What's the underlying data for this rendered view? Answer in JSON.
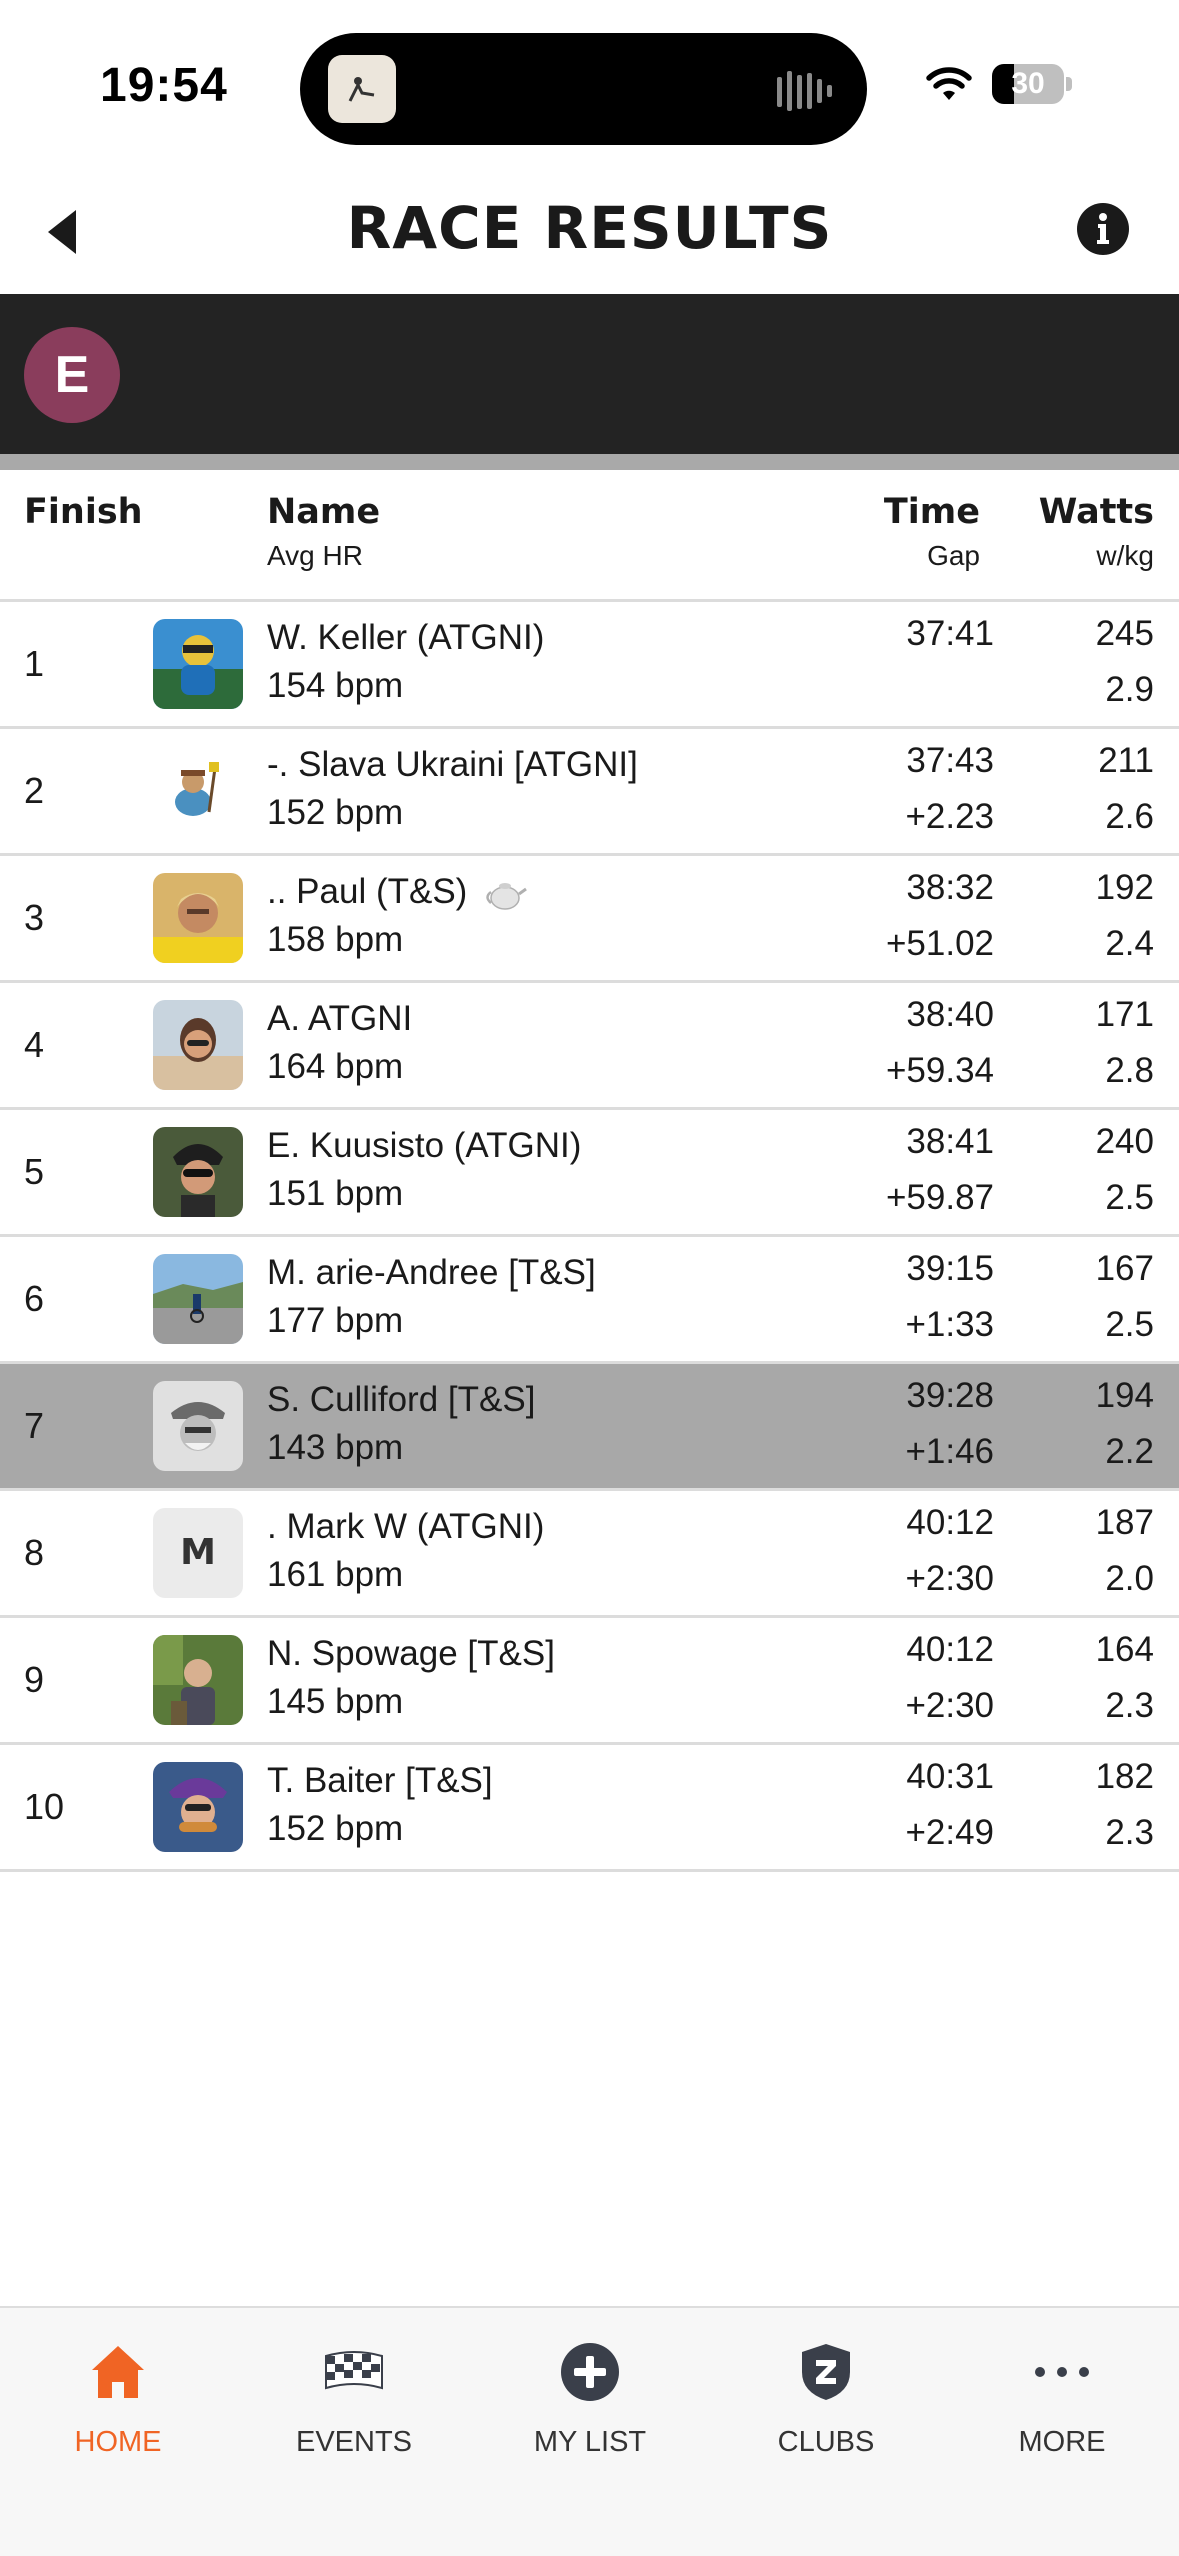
{
  "status": {
    "time": "19:54",
    "battery": "30",
    "battery_fraction": 0.3
  },
  "header": {
    "title": "RACE RESULTS"
  },
  "category": {
    "badge": "E",
    "color": "#8a3d5c"
  },
  "columns": {
    "finish": "Finish",
    "name": "Name",
    "name_sub": "Avg HR",
    "time": "Time",
    "time_sub": "Gap",
    "watts": "Watts",
    "watts_sub": "w/kg"
  },
  "rows": [
    {
      "pos": "1",
      "name": "W. Keller (ATGNI)",
      "hr": "154 bpm",
      "time": "37:41",
      "gap": "",
      "watts": "245",
      "wkg": "2.9",
      "avatar": "photo-cyclist"
    },
    {
      "pos": "2",
      "name": "-. Slava Ukraini [ATGNI]",
      "hr": "152 bpm",
      "time": "37:43",
      "gap": "+2.23",
      "watts": "211",
      "wkg": "2.6",
      "avatar": "cartoon"
    },
    {
      "pos": "3",
      "name": ".. Paul (T&S)",
      "hr": "158 bpm",
      "time": "38:32",
      "gap": "+51.02",
      "watts": "192",
      "wkg": "2.4",
      "avatar": "photo-portrait",
      "badge_icon": "teapot-icon"
    },
    {
      "pos": "4",
      "name": "A. ATGNI",
      "hr": "164 bpm",
      "time": "38:40",
      "gap": "+59.34",
      "watts": "171",
      "wkg": "2.8",
      "avatar": "photo-beach"
    },
    {
      "pos": "5",
      "name": "E. Kuusisto (ATGNI)",
      "hr": "151 bpm",
      "time": "38:41",
      "gap": "+59.87",
      "watts": "240",
      "wkg": "2.5",
      "avatar": "photo-helmet"
    },
    {
      "pos": "6",
      "name": "M. arie-Andree [T&S]",
      "hr": "177 bpm",
      "time": "39:15",
      "gap": "+1:33",
      "watts": "167",
      "wkg": "2.5",
      "avatar": "photo-road"
    },
    {
      "pos": "7",
      "name": "S. Culliford [T&S]",
      "hr": "143 bpm",
      "time": "39:28",
      "gap": "+1:46",
      "watts": "194",
      "wkg": "2.2",
      "avatar": "photo-bw",
      "highlight": true
    },
    {
      "pos": "8",
      "name": ". Mark W (ATGNI)",
      "hr": "161 bpm",
      "time": "40:12",
      "gap": "+2:30",
      "watts": "187",
      "wkg": "2.0",
      "avatar": "letter",
      "avatar_letter": "M"
    },
    {
      "pos": "9",
      "name": "N. Spowage [T&S]",
      "hr": "145 bpm",
      "time": "40:12",
      "gap": "+2:30",
      "watts": "164",
      "wkg": "2.3",
      "avatar": "photo-garden"
    },
    {
      "pos": "10",
      "name": "T. Baiter [T&S]",
      "hr": "152 bpm",
      "time": "40:31",
      "gap": "+2:49",
      "watts": "182",
      "wkg": "2.3",
      "avatar": "photo-eating"
    }
  ],
  "tabs": [
    {
      "label": "HOME",
      "icon": "home-icon",
      "active": true
    },
    {
      "label": "EVENTS",
      "icon": "checkered-flag-icon",
      "active": false
    },
    {
      "label": "MY LIST",
      "icon": "plus-circle-icon",
      "active": false
    },
    {
      "label": "CLUBS",
      "icon": "shield-icon",
      "active": false
    },
    {
      "label": "MORE",
      "icon": "more-icon",
      "active": false
    }
  ],
  "colors": {
    "accent": "#f06424",
    "header_band": "#232323",
    "highlight_row": "#a8a8a8"
  }
}
